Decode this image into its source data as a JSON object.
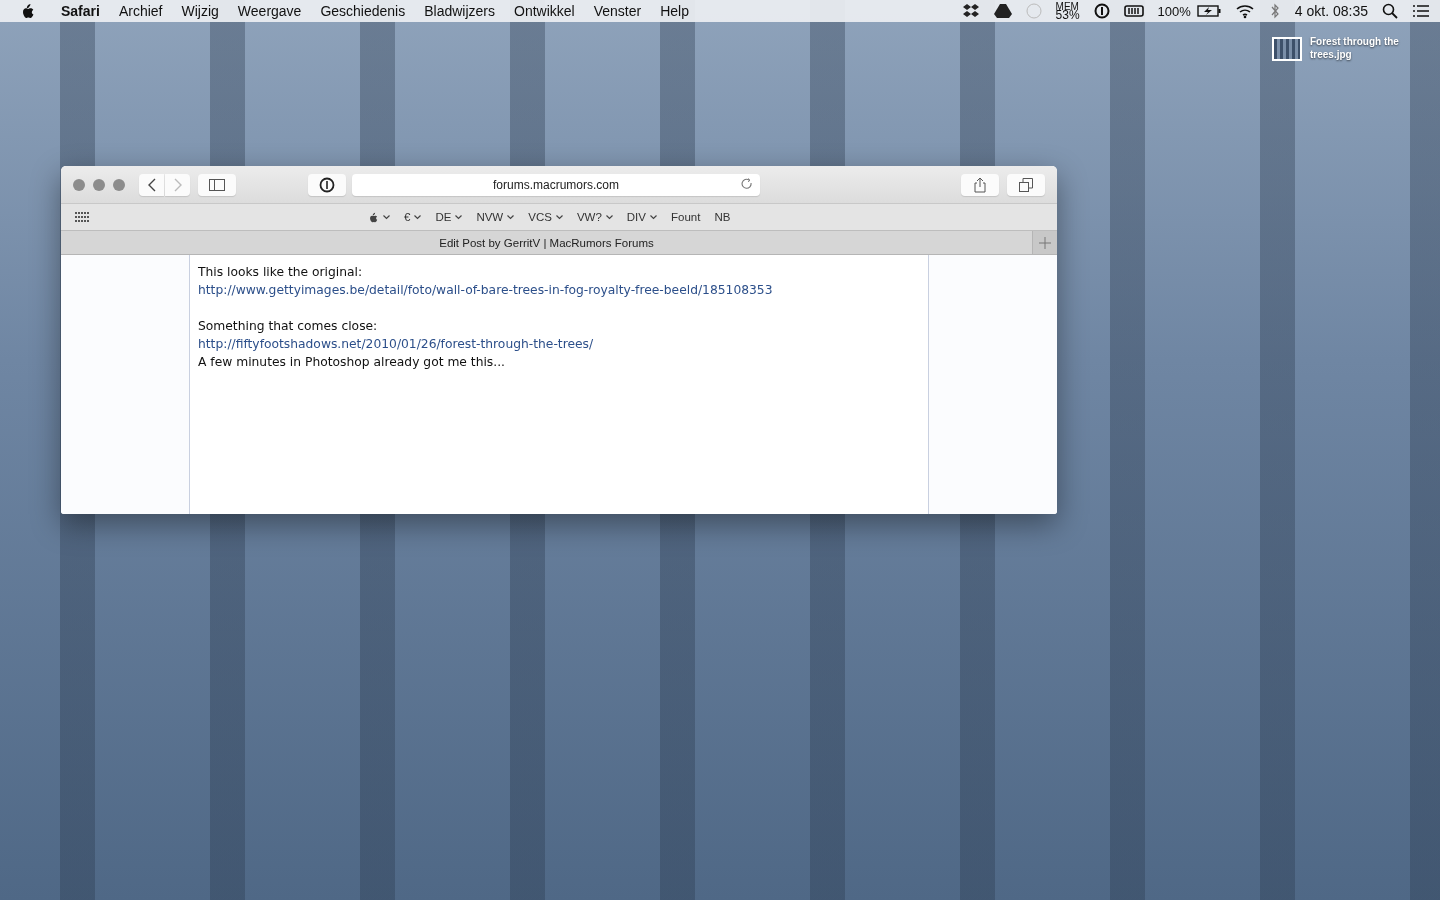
{
  "menu_bar": {
    "app": "Safari",
    "menus": [
      "Archief",
      "Wijzig",
      "Weergave",
      "Geschiedenis",
      "Bladwijzers",
      "Ontwikkel",
      "Venster",
      "Help"
    ],
    "memory": {
      "label": "MEM",
      "value": "53%"
    },
    "battery": "100%",
    "clock": "4 okt. 08:35"
  },
  "desktop_icon": {
    "label": "Forest through the trees.jpg"
  },
  "window": {
    "address": "forums.macrumors.com",
    "bookmarks": [
      {
        "kind": "apple",
        "folder": true
      },
      {
        "kind": "text",
        "label": "€",
        "folder": true
      },
      {
        "kind": "text",
        "label": "DE",
        "folder": true
      },
      {
        "kind": "text",
        "label": "NVW",
        "folder": true
      },
      {
        "kind": "text",
        "label": "VCS",
        "folder": true
      },
      {
        "kind": "text",
        "label": "VW?",
        "folder": true
      },
      {
        "kind": "text",
        "label": "DIV",
        "folder": true
      },
      {
        "kind": "text",
        "label": "Fount",
        "folder": false
      },
      {
        "kind": "text",
        "label": "NB",
        "folder": false
      }
    ],
    "tab_title": "Edit Post by GerritV | MacRumors Forums",
    "content": [
      {
        "kind": "text",
        "text": "This looks like the original:"
      },
      {
        "kind": "link",
        "text": "http://www.gettyimages.be/detail/foto/wall-of-bare-trees-in-fog-royalty-free-beeld/185108353"
      },
      {
        "kind": "blank"
      },
      {
        "kind": "text",
        "text": "Something that comes close:"
      },
      {
        "kind": "link",
        "text": "http://fiftyfootshadows.net/2010/01/26/forest-through-the-trees/"
      },
      {
        "kind": "text",
        "text": "A few minutes in Photoshop already got me this..."
      }
    ]
  }
}
